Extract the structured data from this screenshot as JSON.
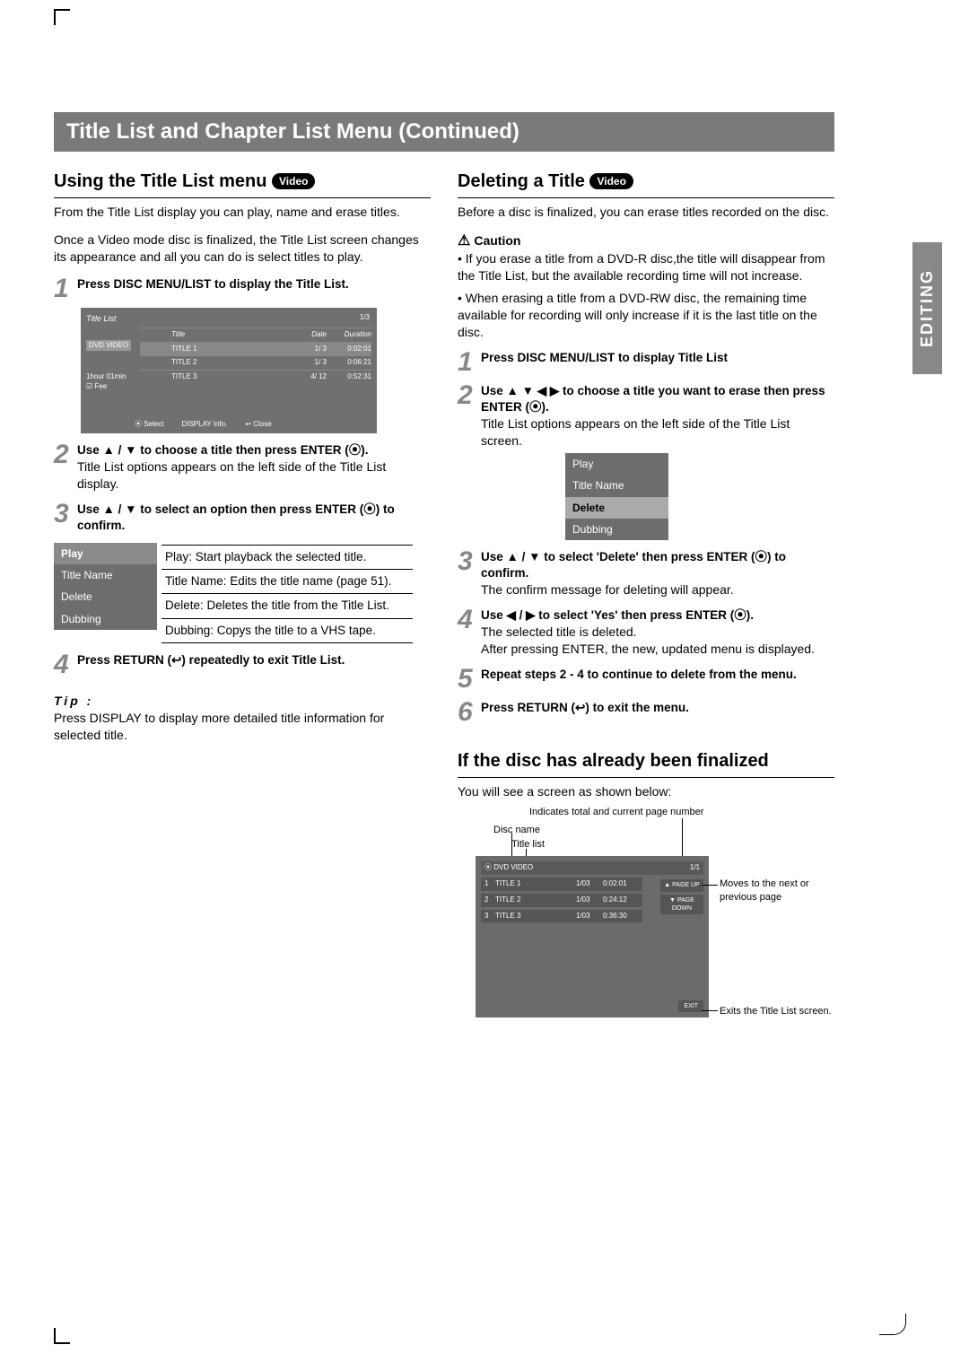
{
  "sideTab": "EDITING",
  "titleBar": "Title List and Chapter List Menu (Continued)",
  "left": {
    "heading": "Using the Title List menu",
    "badge": "Video",
    "intro1": "From the Title List display you can play, name and erase titles.",
    "intro2": "Once a Video mode disc is finalized, the Title List screen changes its appearance and all you can do is select titles to play.",
    "step1": "Press DISC MENU/LIST to display the Title List.",
    "tl": {
      "header": "Title List",
      "page": "1/3",
      "side": "DVD VIDEO",
      "side2": "1hour 01min",
      "side3": "☑ Fee",
      "cols": {
        "c1": "",
        "c2": "Title",
        "c3": "Date",
        "c4": "Duration"
      },
      "rows": [
        {
          "n": "",
          "t": "TITLE 1",
          "d": "1/ 3",
          "dur": "0:02:01"
        },
        {
          "n": "",
          "t": "TITLE 2",
          "d": "1/ 3",
          "dur": "0:06:21"
        },
        {
          "n": "",
          "t": "TITLE 3",
          "d": "4/ 12",
          "dur": "0:52:31"
        }
      ],
      "foot": {
        "a": "⦿ Select",
        "b": "DISPLAY Info.",
        "c": "↩ Close"
      }
    },
    "step2": "Use ▲ / ▼ to choose a title then press ENTER (⦿).",
    "step2sub": "Title List options appears on the left side of the Title List display.",
    "step3": "Use ▲ / ▼ to select an option then press ENTER (⦿) to confirm.",
    "menu": {
      "play": "Play",
      "tn": "Title Name",
      "del": "Delete",
      "dub": "Dubbing"
    },
    "opts": {
      "play": "Play: Start playback the selected title.",
      "tn": "Title Name: Edits the title name (page 51).",
      "del": "Delete: Deletes the title from the Title List.",
      "dub": "Dubbing: Copys the title to a VHS tape."
    },
    "step4": "Press RETURN (↩) repeatedly to exit Title List.",
    "tipLabel": "Tip :",
    "tip": "Press DISPLAY to display more detailed title information for selected title."
  },
  "right": {
    "heading": "Deleting a Title",
    "badge": "Video",
    "intro": "Before a disc is finalized, you can erase titles recorded on the disc.",
    "cautionHead": "Caution",
    "caution1": "If you erase a title from a DVD-R disc,the title will disappear from the Title List, but the available recording time will not increase.",
    "caution2": "When erasing a title from a DVD-RW disc, the remaining time available for recording will only increase if it is the last title on the disc.",
    "step1": "Press DISC MENU/LIST to display Title List",
    "step2": "Use ▲ ▼ ◀ ▶ to choose a title you want to erase then press ENTER (⦿).",
    "step2sub": "Title List options appears on the left side of the Title List screen.",
    "menu": {
      "play": "Play",
      "tn": "Title Name",
      "del": "Delete",
      "dub": "Dubbing"
    },
    "step3": "Use ▲ / ▼ to select 'Delete' then press ENTER (⦿) to confirm.",
    "step3sub": "The confirm message for deleting will appear.",
    "step4": "Use ◀ / ▶ to select 'Yes' then press ENTER (⦿).",
    "step4sub": "The selected title is deleted.",
    "step4sub2": "After pressing ENTER, the new, updated menu is displayed.",
    "step5": "Repeat steps 2 - 4 to continue to delete from the menu.",
    "step6": "Press RETURN (↩) to exit the menu.",
    "fin": {
      "heading": "If the disc has already been finalized",
      "sub": "You will see a screen as shown below:",
      "lbl1": "Indicates total and current page number",
      "lbl2": "Disc name",
      "lbl3": "Title list",
      "lbl4": "Moves to the next or previous page",
      "lbl5": "Exits the Title List screen.",
      "top1": "⦿ DVD VIDEO",
      "top2": "1/1",
      "rows": [
        {
          "n": "1",
          "t": "TITLE 1",
          "d": "1/03",
          "dur": "0:02:01"
        },
        {
          "n": "2",
          "t": "TITLE 2",
          "d": "1/03",
          "dur": "0:24:12"
        },
        {
          "n": "3",
          "t": "TITLE 3",
          "d": "1/03",
          "dur": "0:36:30"
        }
      ],
      "pgup": "▲ PAGE UP",
      "pgdn": "▼ PAGE DOWN",
      "exit": "EXIT"
    }
  }
}
